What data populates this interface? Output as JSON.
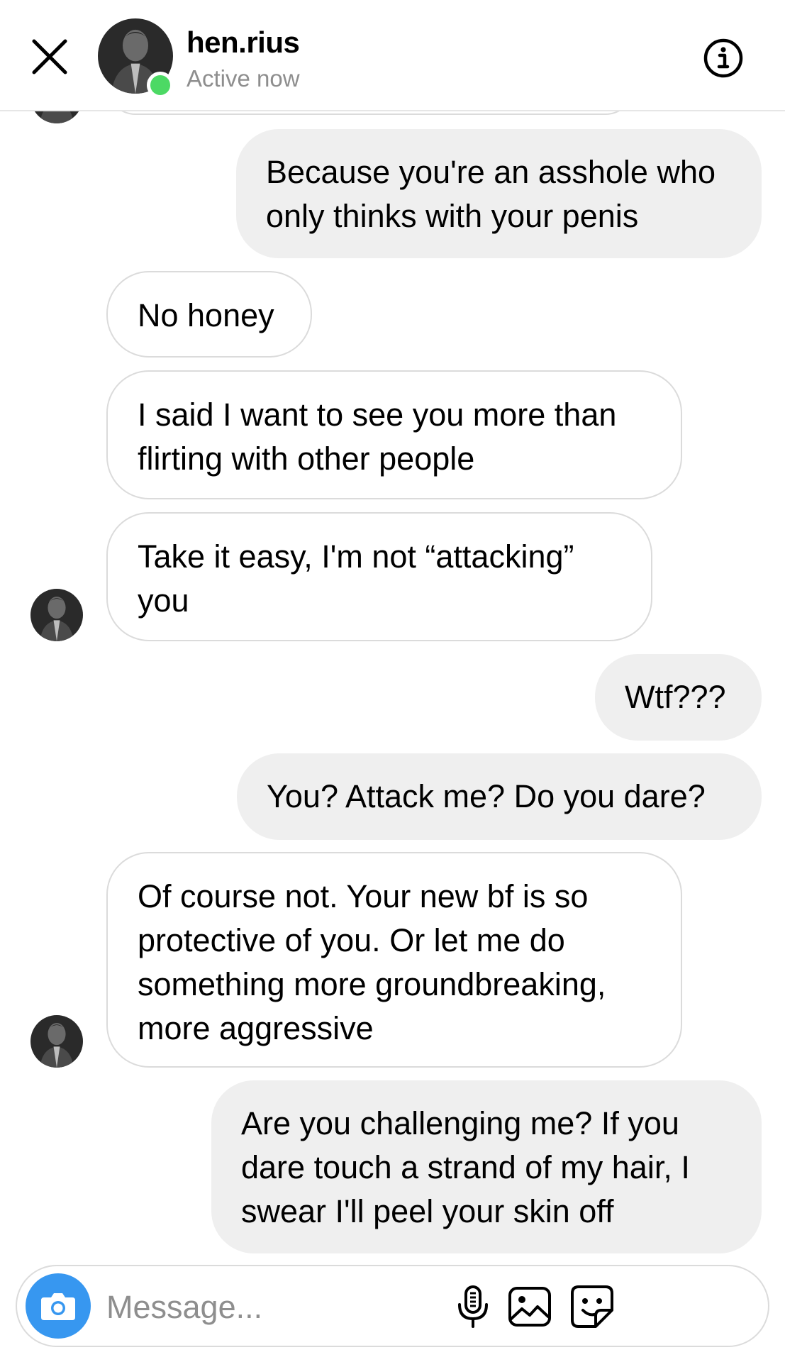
{
  "header": {
    "username": "hen.rius",
    "status": "Active now",
    "online_color": "#4cd964",
    "close_icon": "close-icon",
    "info_icon": "info-icon"
  },
  "messages": [
    {
      "side": "out",
      "text": "Because you're an asshole who\nonly thinks with your penis"
    },
    {
      "side": "in",
      "text": "No honey"
    },
    {
      "side": "in",
      "text": "I said I want to see you more than\nflirting with other people"
    },
    {
      "side": "in",
      "text": "Take it easy, I'm not “attacking”\nyou"
    },
    {
      "side": "out",
      "text": "Wtf???"
    },
    {
      "side": "out",
      "text": "You? Attack me? Do you dare?"
    },
    {
      "side": "in",
      "text": "Of course not. Your new bf is so\nprotective of you. Or let me do\nsomething more groundbreaking,\nmore aggressive"
    },
    {
      "side": "out",
      "text": "Are you challenging me? If you\ndare touch a strand of my hair, I\nswear I'll peel your skin off"
    }
  ],
  "composer": {
    "placeholder": "Message...",
    "value": "",
    "camera_icon": "camera-icon",
    "mic_icon": "microphone-icon",
    "gallery_icon": "gallery-icon",
    "sticker_icon": "sticker-icon",
    "accent_color": "#3797f0"
  }
}
